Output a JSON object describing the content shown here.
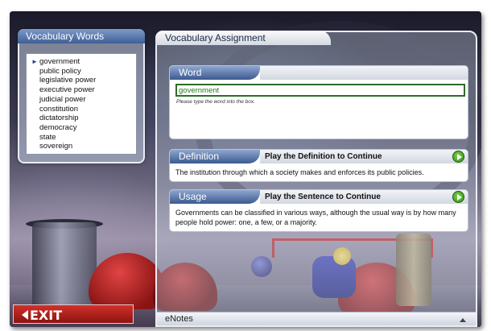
{
  "vocab_panel": {
    "title": "Vocabulary Words",
    "items": [
      {
        "label": "government",
        "selected": true
      },
      {
        "label": "public policy"
      },
      {
        "label": "legislative power"
      },
      {
        "label": "executive power"
      },
      {
        "label": "judicial power"
      },
      {
        "label": "constitution"
      },
      {
        "label": "dictatorship"
      },
      {
        "label": "democracy"
      },
      {
        "label": "state"
      },
      {
        "label": "sovereign"
      }
    ]
  },
  "assignment": {
    "title": "Vocabulary Assignment",
    "word": {
      "label": "Word",
      "input_value": "government",
      "hint": "Please type the word into the box."
    },
    "definition": {
      "label": "Definition",
      "play_label": "Play the Definition to Continue",
      "text": "The institution through which a society makes and enforces its public policies."
    },
    "usage": {
      "label": "Usage",
      "play_label": "Play the Sentence to Continue",
      "text": "Governments can be classified in various ways, although the usual way is by how many people hold power: one, a few, or a majority."
    },
    "enotes_label": "eNotes"
  },
  "exit_label": "EXIT",
  "colors": {
    "tab_blue": "#3f5f96",
    "play_green": "#2f8a18",
    "exit_red": "#c42020"
  }
}
